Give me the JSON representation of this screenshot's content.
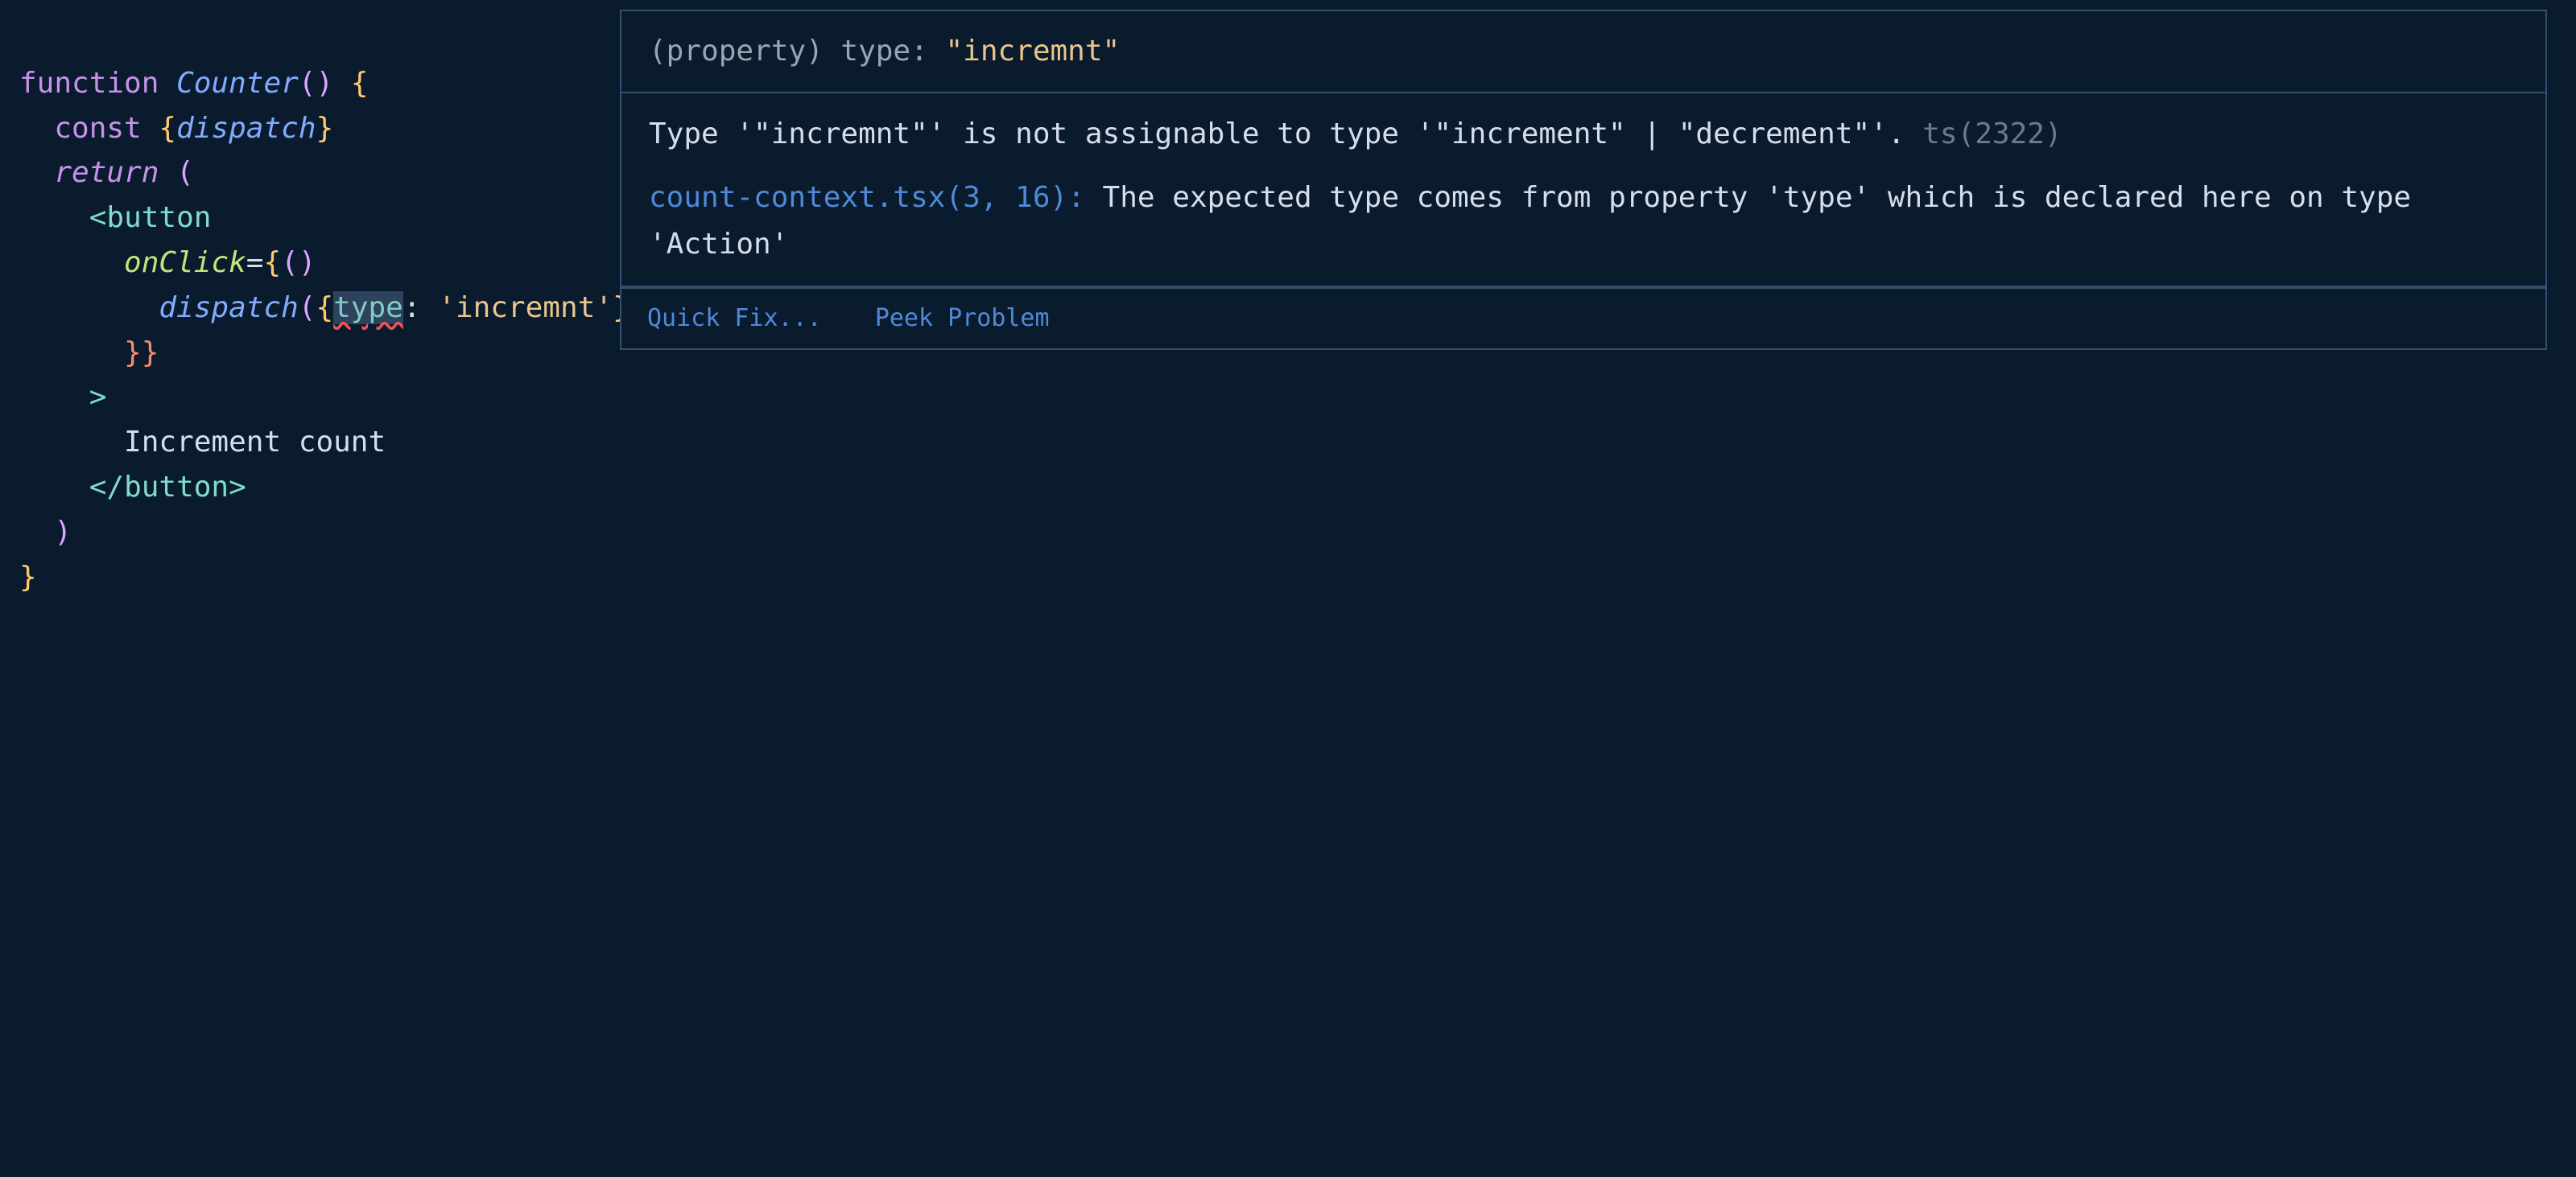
{
  "code": {
    "fn_kw": "function",
    "fn_name": "Counter",
    "const_kw": "const",
    "dispatch": "dispatch",
    "return_kw": "return",
    "button_tag": "button",
    "onclick_attr": "onClick",
    "type_prop": "type",
    "type_value": "'incremnt'",
    "button_text": "Increment count"
  },
  "hover": {
    "signature_prefix": "(property) type: ",
    "signature_value": "\"incremnt\"",
    "error_line1": "Type '\"incremnt\"' is not assignable to type '\"increment\" | \"decrement\"'.",
    "error_code": "ts(2322)",
    "source_link": "count-context.tsx(3, 16):",
    "source_text": " The expected type comes from property 'type' which is declared here on type 'Action'",
    "quick_fix": "Quick Fix...",
    "peek_problem": "Peek Problem"
  }
}
